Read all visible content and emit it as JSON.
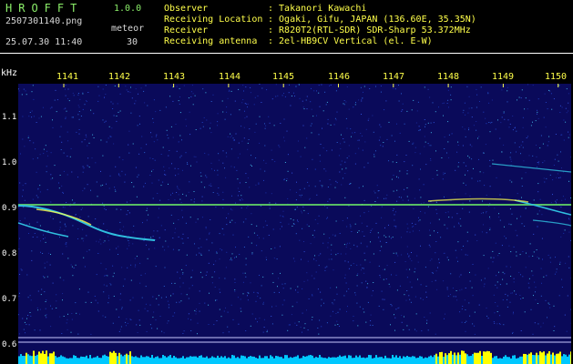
{
  "app": {
    "title": "HROFFT",
    "version": "1.0.0"
  },
  "file": {
    "name": "2507301140.png",
    "timestamp": "25.07.30 11:40"
  },
  "mode": {
    "label": "meteor",
    "count": "30"
  },
  "info": {
    "observer": {
      "key": "Observer",
      "value": ": Takanori Kawachi"
    },
    "location": {
      "key": "Receiving Location",
      "value": ": Ogaki, Gifu, JAPAN (136.60E, 35.35N)"
    },
    "receiver": {
      "key": "Receiver",
      "value": ": R820T2(RTL-SDR) SDR-Sharp 53.372MHz"
    },
    "antenna": {
      "key": "Receiving antenna",
      "value": ": 2el-HB9CV Vertical (el. E-W)"
    }
  },
  "axes": {
    "freq_unit": "kHz",
    "time_labels": [
      "1141",
      "1142",
      "1143",
      "1144",
      "1145",
      "1146",
      "1147",
      "1148",
      "1149",
      "1150"
    ],
    "freq_labels": [
      "1.1",
      "1.0",
      "0.9",
      "0.8",
      "0.7",
      "0.6"
    ]
  },
  "colors": {
    "background": "#000000",
    "noise_background": "#0a0a5a",
    "title_green": "#8cf06a",
    "info_yellow": "#ffff4a",
    "carrier_line": "#66dd66",
    "meteor_trail": "#30c0e0",
    "strong_echo": "#ffff4a",
    "level_bar_base": "#00c8ff",
    "level_bar_peak": "#ffff00"
  }
}
